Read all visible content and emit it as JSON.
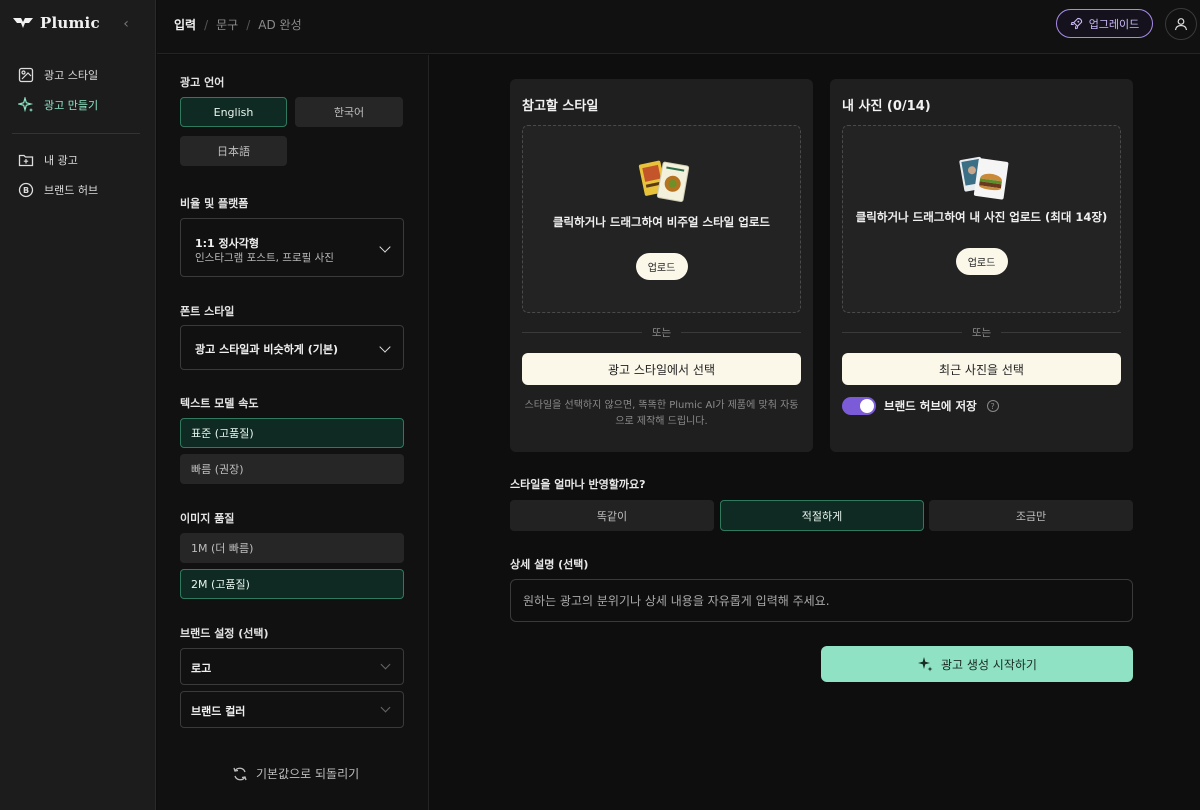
{
  "app": {
    "name": "Plumic",
    "collapse_icon": "chevron-left-icon"
  },
  "nav": {
    "items": [
      {
        "label": "광고 스타일",
        "icon": "style-icon",
        "active": false
      },
      {
        "label": "광고 만들기",
        "icon": "sparkle-icon",
        "active": true
      },
      {
        "label": "내 광고",
        "icon": "folder-plus-icon",
        "active": false
      },
      {
        "label": "브랜드 허브",
        "icon": "brand-b-icon",
        "active": false
      }
    ]
  },
  "breadcrumb": [
    "입력",
    "문구",
    "AD 완성"
  ],
  "topbar": {
    "upgrade_label": "업그레이드"
  },
  "settings": {
    "language": {
      "label": "광고 언어",
      "options": [
        "English",
        "한국어",
        "日本語"
      ],
      "selected": "English"
    },
    "ratio": {
      "label": "비율 및 플랫폼",
      "main": "1:1 정사각형",
      "sub": "인스타그램 포스트, 프로필 사진"
    },
    "font": {
      "label": "폰트 스타일",
      "value": "광고 스타일과 비슷하게 (기본)"
    },
    "speed": {
      "label": "텍스트 모델 속도",
      "options": [
        "표준 (고품질)",
        "빠름 (권장)"
      ],
      "selected": "표준 (고품질)"
    },
    "quality": {
      "label": "이미지 품질",
      "options": [
        "1M (더 빠름)",
        "2M (고품질)"
      ],
      "selected": "2M (고품질)"
    },
    "brand": {
      "label": "브랜드 설정 (선택)",
      "logo": "로고",
      "color": "브랜드 컬러"
    },
    "reset_label": "기본값으로 되돌리기"
  },
  "reference": {
    "title": "참고할 스타일",
    "dropzone_text": "클릭하거나 드래그하여 비주얼 스타일 업로드",
    "upload_label": "업로드",
    "or": "또는",
    "select_label": "광고 스타일에서 선택",
    "hint": "스타일을 선택하지 않으면, 똑똑한 Plumic AI가 제품에 맞춰 자동으로 제작해 드립니다."
  },
  "photos": {
    "title": "내 사진 (0/14)",
    "dropzone_text": "클릭하거나 드래그하여 내 사진 업로드 (최대 14장)",
    "upload_label": "업로드",
    "or": "또는",
    "select_label": "최근 사진을 선택",
    "save_label": "브랜드 허브에 저장",
    "save_enabled": true,
    "help": "?"
  },
  "style_strength": {
    "label": "스타일을 얼마나 반영할까요?",
    "options": [
      "똑같이",
      "적절하게",
      "조금만"
    ],
    "selected": "적절하게"
  },
  "detail": {
    "label": "상세 설명 (선택)",
    "placeholder": "원하는 광고의 분위기나 상세 내용을 자유롭게 입력해 주세요."
  },
  "generate_label": "광고 생성 시작하기",
  "colors": {
    "accent": "#8fe3c4",
    "selected_bg": "#0f2a22",
    "toggle": "#7c5bd8",
    "cream": "#fbf8ea"
  }
}
